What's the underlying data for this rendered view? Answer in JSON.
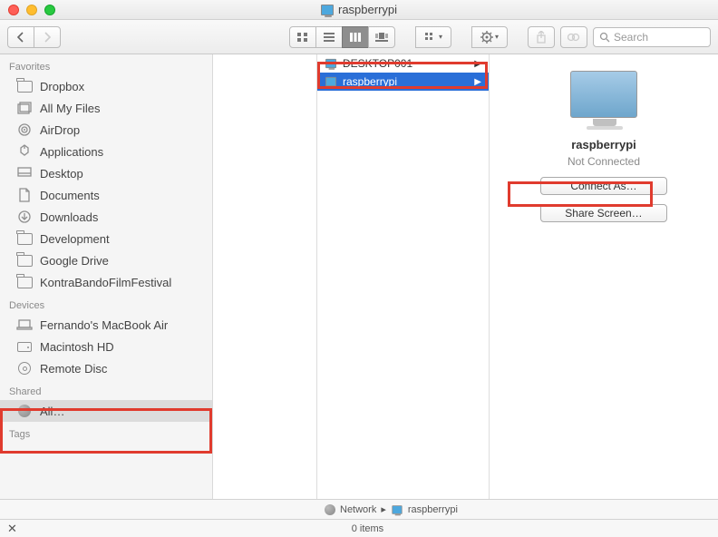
{
  "window": {
    "title": "raspberrypi"
  },
  "search": {
    "placeholder": "Search"
  },
  "sidebar": {
    "favorites_header": "Favorites",
    "favorites": [
      {
        "label": "Dropbox"
      },
      {
        "label": "All My Files"
      },
      {
        "label": "AirDrop"
      },
      {
        "label": "Applications"
      },
      {
        "label": "Desktop"
      },
      {
        "label": "Documents"
      },
      {
        "label": "Downloads"
      },
      {
        "label": "Development"
      },
      {
        "label": "Google Drive"
      },
      {
        "label": "KontraBandoFilmFestival"
      }
    ],
    "devices_header": "Devices",
    "devices": [
      {
        "label": "Fernando's MacBook Air"
      },
      {
        "label": "Macintosh HD"
      },
      {
        "label": "Remote Disc"
      }
    ],
    "shared_header": "Shared",
    "shared": [
      {
        "label": "All…"
      }
    ],
    "tags_header": "Tags"
  },
  "column": {
    "items": [
      {
        "label": "DESKTOP001",
        "selected": false
      },
      {
        "label": "raspberrypi",
        "selected": true
      }
    ]
  },
  "preview": {
    "name": "raspberrypi",
    "status": "Not Connected",
    "connect_label": "Connect As…",
    "share_label": "Share Screen…"
  },
  "pathbar": {
    "root": "Network",
    "leaf": "raspberrypi"
  },
  "status": {
    "items": "0 items"
  }
}
